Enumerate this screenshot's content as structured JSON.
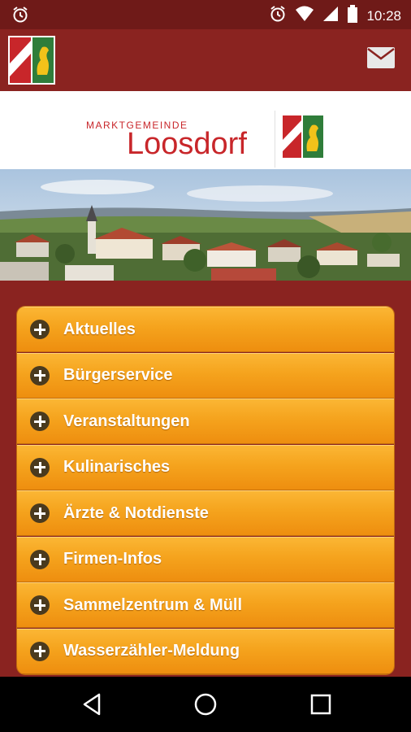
{
  "status_bar": {
    "time": "10:28",
    "icons": [
      "alarm-icon",
      "wifi-icon",
      "signal-icon",
      "battery-icon"
    ]
  },
  "app_bar": {
    "logo_icon": "municipal-crest-icon",
    "mail_icon": "mail-icon"
  },
  "header": {
    "subtitle": "MARKTGEMEINDE",
    "title": "Loosdorf",
    "brand_color": "#c8262a"
  },
  "menu": {
    "items": [
      {
        "label": "Aktuelles"
      },
      {
        "label": "Bürgerservice"
      },
      {
        "label": "Veranstaltungen"
      },
      {
        "label": "Kulinarisches"
      },
      {
        "label": "Ärzte & Notdienste"
      },
      {
        "label": "Firmen-Infos"
      },
      {
        "label": "Sammelzentrum & Müll"
      },
      {
        "label": "Wasserzähler-Meldung"
      }
    ],
    "expand_icon": "plus-icon"
  },
  "colors": {
    "primary": "#8a2320",
    "status": "#6f1a18",
    "menu_orange": "#f5a31d"
  },
  "nav": {
    "icons": [
      "back-icon",
      "home-icon",
      "recents-icon"
    ]
  }
}
